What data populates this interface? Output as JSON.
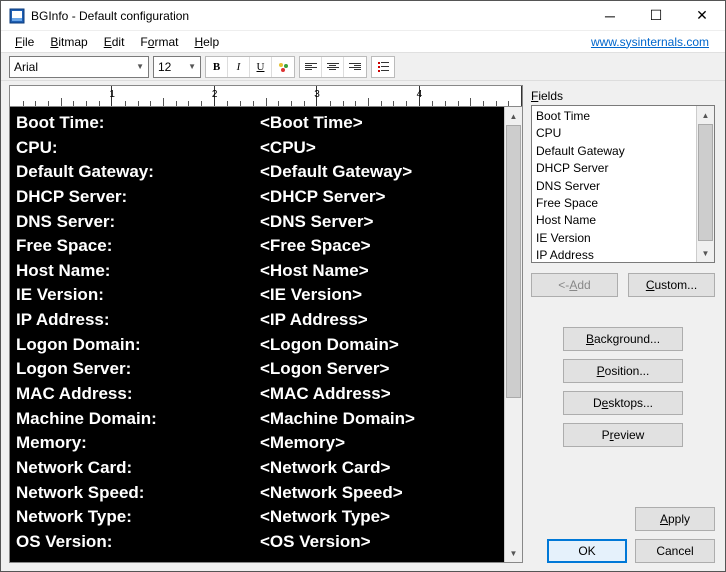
{
  "window": {
    "title": "BGInfo - Default configuration"
  },
  "menubar": {
    "items": [
      "File",
      "Bitmap",
      "Edit",
      "Format",
      "Help"
    ],
    "link": "www.sysinternals.com"
  },
  "toolbar": {
    "font": "Arial",
    "size": "12"
  },
  "editor_rows": [
    {
      "label": "Boot Time:",
      "value": "<Boot Time>"
    },
    {
      "label": "CPU:",
      "value": "<CPU>"
    },
    {
      "label": "Default Gateway:",
      "value": "<Default Gateway>"
    },
    {
      "label": "DHCP Server:",
      "value": "<DHCP Server>"
    },
    {
      "label": "DNS Server:",
      "value": "<DNS Server>"
    },
    {
      "label": "Free Space:",
      "value": "<Free Space>"
    },
    {
      "label": "Host Name:",
      "value": "<Host Name>"
    },
    {
      "label": "IE Version:",
      "value": "<IE Version>"
    },
    {
      "label": "IP Address:",
      "value": "<IP Address>"
    },
    {
      "label": "Logon Domain:",
      "value": "<Logon Domain>"
    },
    {
      "label": "Logon Server:",
      "value": "<Logon Server>"
    },
    {
      "label": "MAC Address:",
      "value": "<MAC Address>"
    },
    {
      "label": "Machine Domain:",
      "value": "<Machine Domain>"
    },
    {
      "label": "Memory:",
      "value": "<Memory>"
    },
    {
      "label": "Network Card:",
      "value": "<Network Card>"
    },
    {
      "label": "Network Speed:",
      "value": "<Network Speed>"
    },
    {
      "label": "Network Type:",
      "value": "<Network Type>"
    },
    {
      "label": "OS Version:",
      "value": "<OS Version>"
    }
  ],
  "fields": {
    "label": "Fields",
    "items": [
      "Boot Time",
      "CPU",
      "Default Gateway",
      "DHCP Server",
      "DNS Server",
      "Free Space",
      "Host Name",
      "IE Version",
      "IP Address"
    ],
    "add": "<- Add",
    "custom": "Custom..."
  },
  "buttons": {
    "background": "Background...",
    "position": "Position...",
    "desktops": "Desktops...",
    "preview": "Preview",
    "apply": "Apply",
    "ok": "OK",
    "cancel": "Cancel"
  },
  "ruler_nums": [
    "1",
    "2",
    "3",
    "4"
  ]
}
